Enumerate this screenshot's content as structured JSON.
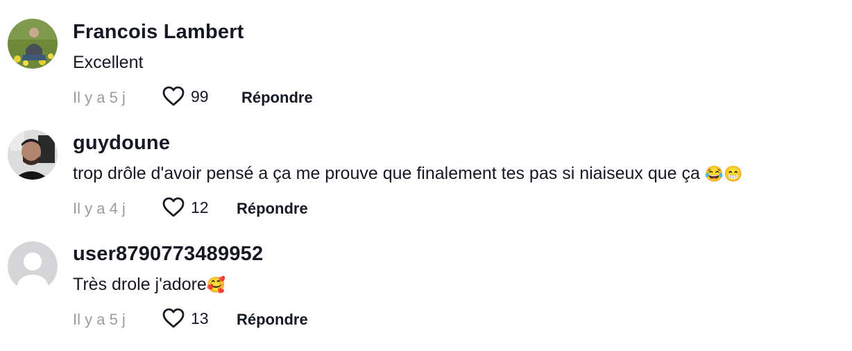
{
  "comments": [
    {
      "username": "Francois Lambert",
      "text": "Excellent",
      "time": "Il y a 5 j",
      "likes": "99",
      "reply_label": "Répondre",
      "avatar": "photo"
    },
    {
      "username": "guydoune",
      "text": "trop drôle d'avoir pensé a ça me prouve que finalement tes pas si niaiseux que ça",
      "emoji": "😂😁",
      "time": "Il y a 4 j",
      "likes": "12",
      "reply_label": "Répondre",
      "avatar": "photo"
    },
    {
      "username": "user8790773489952",
      "text": "Très drole j'adore",
      "emoji": "🥰",
      "time": "Il y a 5 j",
      "likes": "13",
      "reply_label": "Répondre",
      "avatar": "default-user-icon"
    }
  ],
  "icons": {
    "like": "heart-outline-icon"
  },
  "colors": {
    "text": "#161823",
    "secondary": "#9a9ba0",
    "default_avatar_bg": "#d5d5d7"
  }
}
